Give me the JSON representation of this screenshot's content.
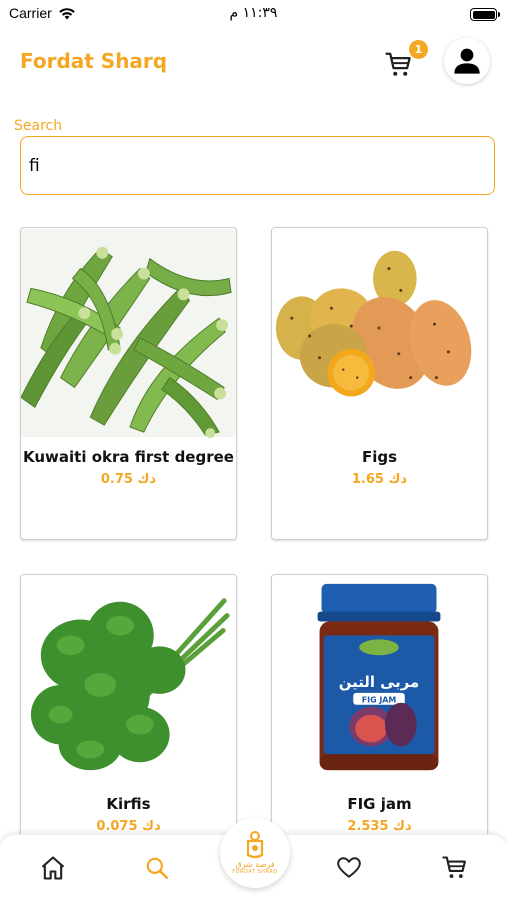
{
  "status_bar": {
    "carrier": "Carrier",
    "time": "١١:٣٩ م"
  },
  "header": {
    "brand": "Fordat Sharq",
    "cart_count": "1"
  },
  "search": {
    "label": "Search",
    "value": "fi"
  },
  "products": [
    {
      "name": "Kuwaiti okra first degree",
      "price": "0.75 دك",
      "image": "okra"
    },
    {
      "name": "Figs",
      "price": "1.65 دك",
      "image": "prickly-pear"
    },
    {
      "name": "Kirfis",
      "price": "0.075 دك",
      "image": "celery"
    },
    {
      "name": "FIG jam",
      "price": "2.535 دك",
      "image": "fig-jam-jar"
    }
  ],
  "jam_label": {
    "arabic": "مربى التين",
    "english": "FIG JAM"
  },
  "bottom_nav": {
    "items": [
      "home-icon",
      "search-icon",
      "logo",
      "heart-icon",
      "cart-icon"
    ],
    "active": "search-icon",
    "logo_ar": "فرصة شرق",
    "logo_en": "FORDAT SHARQ"
  },
  "colors": {
    "accent": "#f5a623",
    "text": "#111111"
  }
}
